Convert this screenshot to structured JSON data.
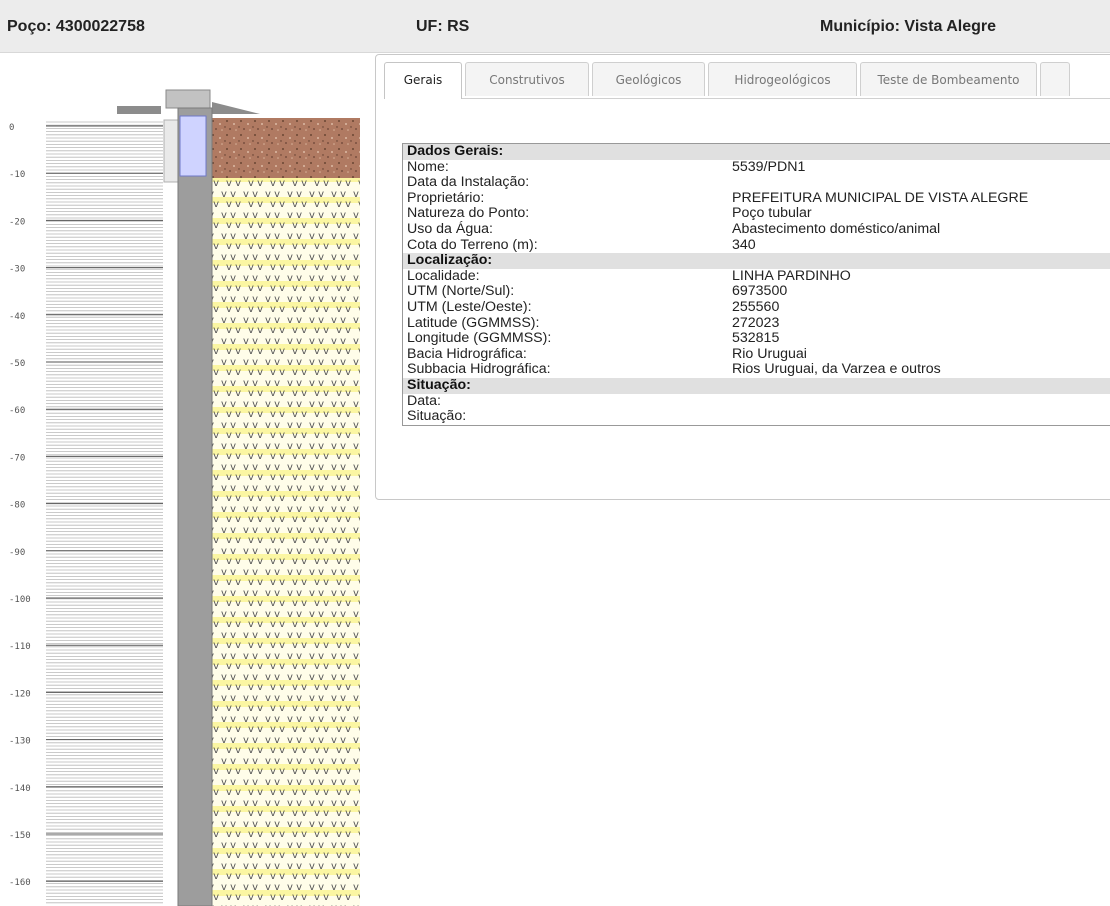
{
  "header": {
    "poco": "Poço: 4300022758",
    "uf": "UF: RS",
    "municipio": "Município: Vista Alegre"
  },
  "profile": {
    "depth_ticks": [
      "0",
      "-10",
      "-20",
      "-30",
      "-40",
      "-50",
      "-60",
      "-70",
      "-80",
      "-90",
      "-100",
      "-110",
      "-120",
      "-130",
      "-140",
      "-150",
      "-160"
    ]
  },
  "tabs": [
    {
      "label": "Gerais",
      "active": true
    },
    {
      "label": "Construtivos"
    },
    {
      "label": "Geológicos"
    },
    {
      "label": "Hidrogeológicos"
    },
    {
      "label": "Teste de Bombeamento"
    }
  ],
  "sections": [
    {
      "title": "Dados Gerais:",
      "rows": [
        {
          "k": "Nome:",
          "v": "5539/PDN1"
        },
        {
          "k": "Data da Instalação:",
          "v": ""
        },
        {
          "k": "Proprietário:",
          "v": "PREFEITURA MUNICIPAL DE VISTA ALEGRE"
        },
        {
          "k": "Natureza do Ponto:",
          "v": "Poço tubular"
        },
        {
          "k": "Uso da Água:",
          "v": "Abastecimento doméstico/animal"
        },
        {
          "k": "Cota do Terreno (m):",
          "v": "340"
        }
      ]
    },
    {
      "title": "Localização:",
      "rows": [
        {
          "k": "Localidade:",
          "v": "LINHA PARDINHO"
        },
        {
          "k": "UTM (Norte/Sul):",
          "v": "6973500"
        },
        {
          "k": "UTM (Leste/Oeste):",
          "v": "255560"
        },
        {
          "k": "Latitude (GGMMSS):",
          "v": "272023"
        },
        {
          "k": "Longitude (GGMMSS):",
          "v": "532815"
        },
        {
          "k": "Bacia Hidrográfica:",
          "v": "Rio Uruguai"
        },
        {
          "k": "Subbacia Hidrográfica:",
          "v": "Rios Uruguai, da Varzea e outros"
        }
      ]
    },
    {
      "title": "Situação:",
      "rows": [
        {
          "k": "Data:",
          "v": ""
        },
        {
          "k": "Situação:",
          "v": ""
        }
      ]
    }
  ]
}
